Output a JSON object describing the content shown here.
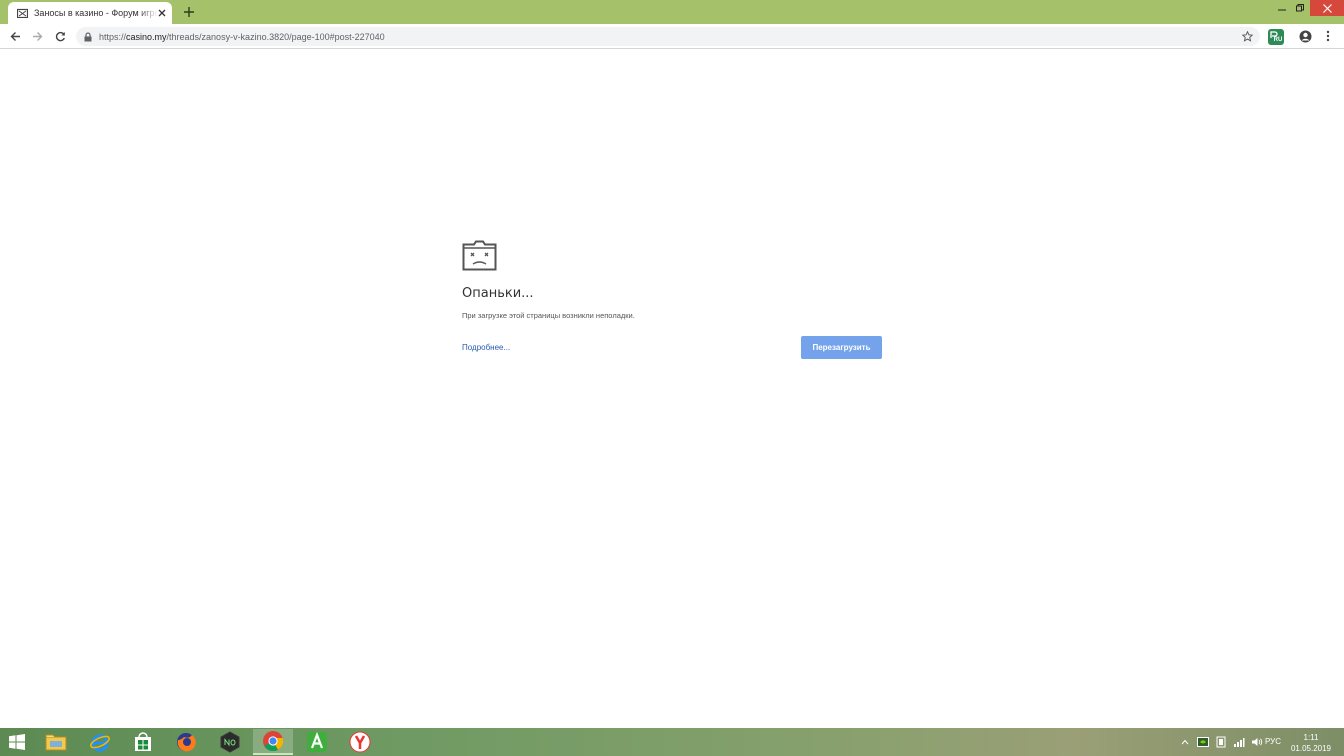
{
  "browser": {
    "tab": {
      "title": "Заносы в казино - Форум игроков",
      "favicon": "broken-page-icon"
    },
    "controls": {
      "new_tab": "plus-icon",
      "minimize": "minimize-icon",
      "maximize": "maximize-icon",
      "close": "close-icon"
    },
    "omnibox": {
      "scheme": "https://",
      "host": "casino.my",
      "path": "/threads/zanosy-v-kazino.3820/page-100#post-227040"
    },
    "extension_badge": "RU"
  },
  "error_page": {
    "icon": "sad-folder-icon",
    "heading": "Опаньки...",
    "description": "При загрузке этой страницы возникли неполадки.",
    "details_link": "Подробнее...",
    "reload_button": "Перезагрузить"
  },
  "taskbar": {
    "apps": [
      "file-explorer-icon",
      "internet-explorer-icon",
      "store-icon",
      "firefox-icon",
      "nox-icon",
      "chrome-icon",
      "android-icon",
      "yandex-browser-icon"
    ],
    "active_app": "chrome-icon",
    "language": "РУС",
    "time": "1:11",
    "date": "01.05.2019"
  },
  "colors": {
    "titlebar": "#a5c16a",
    "close_button": "#d6483b",
    "reload_button": "#74a3ec",
    "link": "#2a5db0"
  }
}
